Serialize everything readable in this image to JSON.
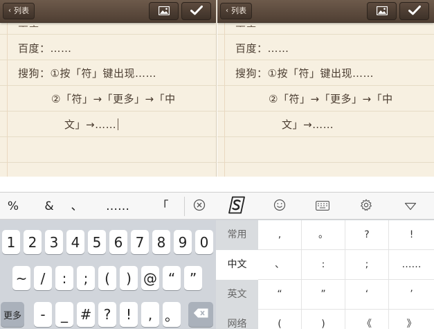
{
  "notes": {
    "left": {
      "back_label": "列表",
      "top_cut_text": "百度",
      "lines": [
        "百度：……",
        "搜狗：①按「符」键出现……",
        "②「符」→「更多」→「中",
        "文」→……"
      ]
    },
    "right": {
      "back_label": "列表",
      "top_cut_text": "百度",
      "lines": [
        "百度：……",
        "搜狗：①按「符」键出现……",
        "②「符」→「更多」→「中",
        "文」→……"
      ]
    }
  },
  "icons": {
    "back": "chevron-left-icon",
    "insert_image": "image-icon",
    "done": "checkmark-icon",
    "clear": "circle-x-icon",
    "sogou": "sogou-logo-icon",
    "emoji": "smiley-icon",
    "keyboard": "keyboard-icon",
    "settings": "gear-icon",
    "hide": "triangle-down-icon",
    "backspace": "backspace-icon"
  },
  "keyboard": {
    "candidates": [
      "%",
      "&",
      "、",
      "……",
      "「"
    ],
    "rows": [
      [
        "1",
        "2",
        "3",
        "4",
        "5",
        "6",
        "7",
        "8",
        "9",
        "0"
      ],
      [
        "~",
        "/",
        ":",
        ";",
        "(",
        ")",
        "@",
        "“",
        "”"
      ],
      [
        "-",
        "_",
        "#",
        "?",
        "!",
        ",",
        "。"
      ]
    ],
    "more_label": "更多",
    "categories": [
      "常用",
      "中文",
      "英文",
      "网络"
    ],
    "active_category": "中文",
    "symbols": [
      [
        ",",
        "。",
        "?",
        "!"
      ],
      [
        "、",
        ":",
        ";",
        "……"
      ],
      [
        "“",
        "”",
        "‘",
        "’"
      ],
      [
        "(",
        ")",
        "《",
        "》"
      ]
    ]
  },
  "colors": {
    "toolbar": "#5a4839",
    "paper": "#f7f0e1",
    "keyboard_bg": "#d1d5db"
  }
}
